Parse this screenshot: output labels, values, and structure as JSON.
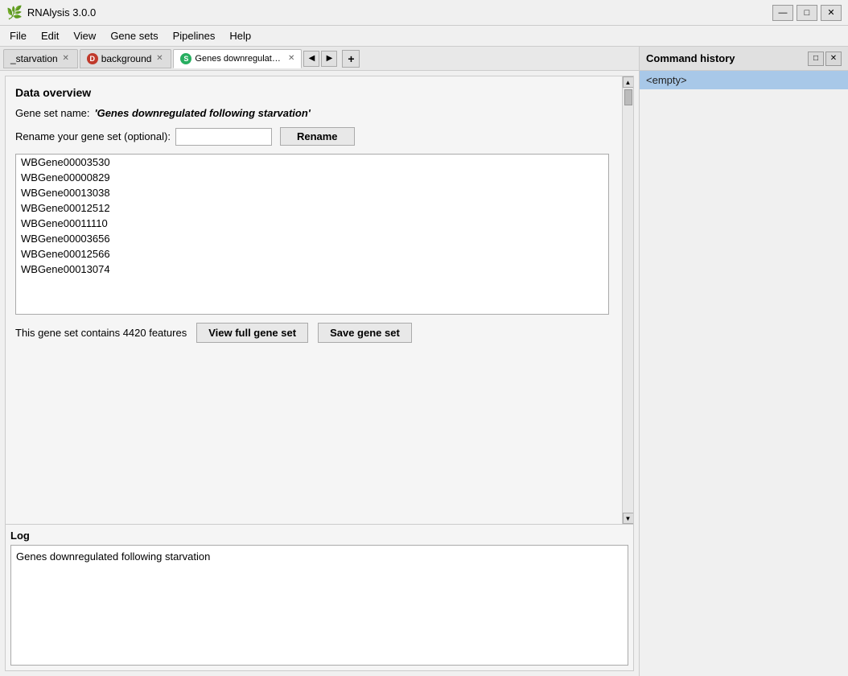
{
  "app": {
    "title": "RNAlysis 3.0.0",
    "icon": "🌿"
  },
  "window_controls": {
    "minimize": "—",
    "maximize": "□",
    "close": "✕"
  },
  "menu": {
    "items": [
      "File",
      "Edit",
      "View",
      "Gene sets",
      "Pipelines",
      "Help"
    ]
  },
  "tabs": [
    {
      "id": "tab1",
      "label": "_starvation",
      "icon_color": null,
      "icon_text": null,
      "active": false
    },
    {
      "id": "tab2",
      "label": "background",
      "icon_color": "#c0392b",
      "icon_text": "D",
      "active": false
    },
    {
      "id": "tab3",
      "label": "Genes downregulated following starvation",
      "icon_color": "#27ae60",
      "icon_text": "S",
      "active": true
    }
  ],
  "tab_nav": {
    "prev": "◀",
    "next": "▶",
    "add": "+"
  },
  "data_overview": {
    "section_title": "Data overview",
    "gene_set_name_label": "Gene set name:",
    "gene_set_name": "'Genes downregulated following starvation'",
    "rename_label": "Rename your gene set (optional):",
    "rename_placeholder": "",
    "rename_button": "Rename",
    "genes": [
      "WBGene00003530",
      "WBGene00000829",
      "WBGene00013038",
      "WBGene00012512",
      "WBGene00011110",
      "WBGene00003656",
      "WBGene00012566",
      "WBGene00013074"
    ],
    "features_text": "This gene set contains 4420 features",
    "view_button": "View full gene set",
    "save_button": "Save gene set"
  },
  "log": {
    "title": "Log",
    "content": "Genes downregulated following starvation"
  },
  "command_history": {
    "title": "Command history",
    "items": [
      "<empty>"
    ],
    "float_btn": "□",
    "close_btn": "✕"
  }
}
